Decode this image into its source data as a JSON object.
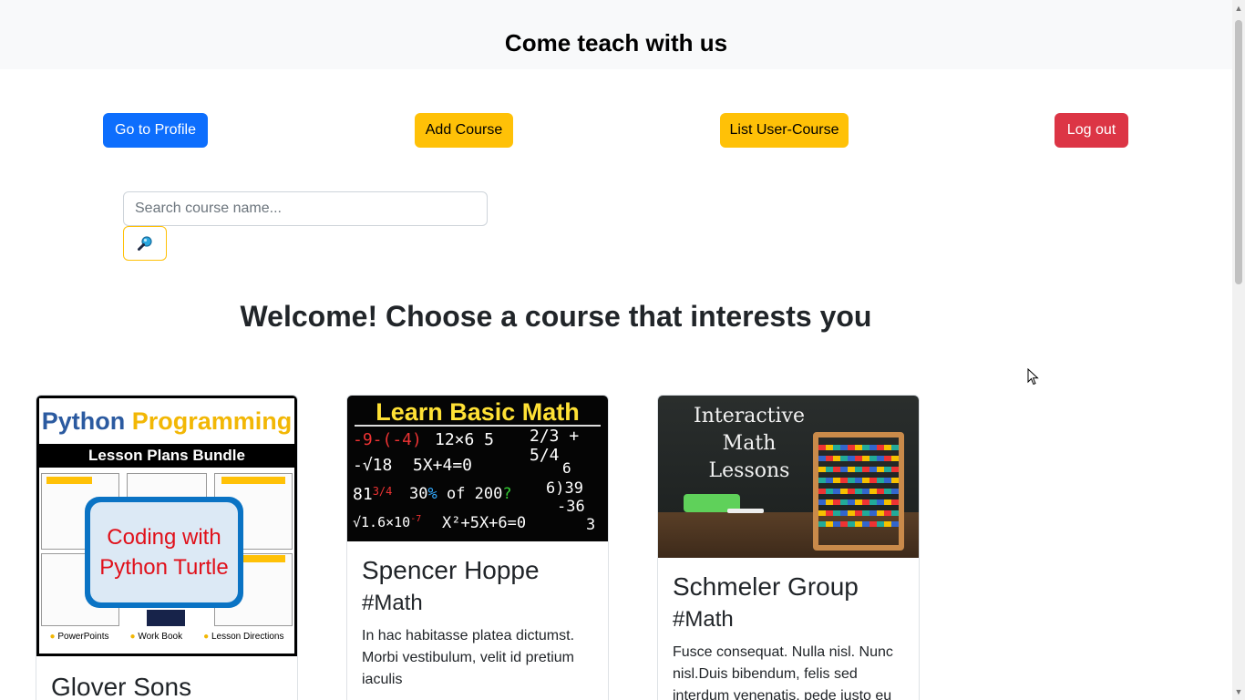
{
  "header": {
    "title": "Come teach with us"
  },
  "nav": {
    "profile_label": "Go to Profile",
    "add_course_label": "Add Course",
    "list_user_course_label": "List User-Course",
    "logout_label": "Log out"
  },
  "search": {
    "placeholder": "Search course name...",
    "value": "",
    "button_icon": "magnifier-icon"
  },
  "main": {
    "heading": "Welcome! Choose a course that interests you"
  },
  "courses": [
    {
      "title": "Glover Sons",
      "image": {
        "heading_part1": "Python",
        "heading_part2": "Programming",
        "subheading": "Lesson Plans Bundle",
        "overlay": "Coding with Python Turtle",
        "footer1": "PowerPoints",
        "footer2": "Work Book",
        "footer3": "Lesson Directions"
      }
    },
    {
      "title": "Spencer Hoppe",
      "tag": "#Math",
      "description": "In hac habitasse platea dictumst. Morbi vestibulum, velit id pretium iaculis",
      "image": {
        "heading": "Learn Basic Math"
      }
    },
    {
      "title": "Schmeler Group",
      "tag": "#Math",
      "description": "Fusce consequat. Nulla nisl. Nunc nisl.Duis bibendum, felis sed interdum venenatis, pede justo eu",
      "image": {
        "heading_line1": "Interactive",
        "heading_line2": "Math",
        "heading_line3": "Lessons"
      }
    }
  ],
  "colors": {
    "primary": "#0d6efd",
    "warning": "#ffc107",
    "danger": "#dc3545",
    "topbar": "#f8f9fa"
  }
}
